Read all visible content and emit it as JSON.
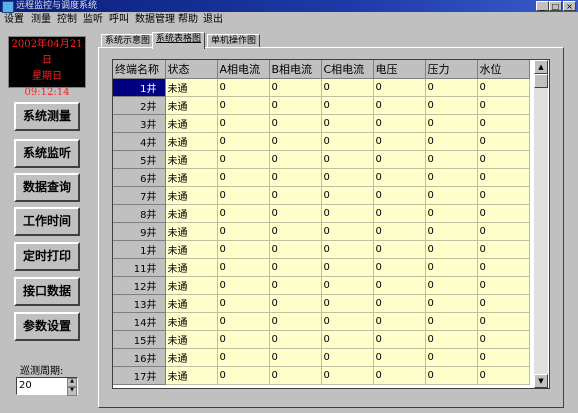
{
  "window": {
    "title": "远程监控与调度系统",
    "min": "_",
    "max": "□",
    "close": "×"
  },
  "menu": [
    "设置",
    "测量",
    "控制",
    "监听",
    "呼叫",
    "数据管理",
    "帮助",
    "退出"
  ],
  "clock": {
    "date": "2002年04月21日",
    "weekday": "星期日",
    "time": "09:12:14"
  },
  "side_buttons": [
    "系统测量",
    "系统监听",
    "数据查询",
    "工作时间",
    "定时打印",
    "接口数据",
    "参数设置"
  ],
  "period": {
    "label": "巡测周期:",
    "value": "20"
  },
  "tabs": [
    "系统示意图",
    "系统表格图",
    "单机操作图"
  ],
  "table": {
    "headers": [
      "终端名称",
      "状态",
      "A相电流",
      "B相电流",
      "C相电流",
      "电压",
      "压力",
      "水位"
    ],
    "rows": [
      [
        "1井",
        "未通",
        "0",
        "0",
        "0",
        "0",
        "0",
        "0"
      ],
      [
        "2井",
        "未通",
        "0",
        "0",
        "0",
        "0",
        "0",
        "0"
      ],
      [
        "3井",
        "未通",
        "0",
        "0",
        "0",
        "0",
        "0",
        "0"
      ],
      [
        "4井",
        "未通",
        "0",
        "0",
        "0",
        "0",
        "0",
        "0"
      ],
      [
        "5井",
        "未通",
        "0",
        "0",
        "0",
        "0",
        "0",
        "0"
      ],
      [
        "6井",
        "未通",
        "0",
        "0",
        "0",
        "0",
        "0",
        "0"
      ],
      [
        "7井",
        "未通",
        "0",
        "0",
        "0",
        "0",
        "0",
        "0"
      ],
      [
        "8井",
        "未通",
        "0",
        "0",
        "0",
        "0",
        "0",
        "0"
      ],
      [
        "9井",
        "未通",
        "0",
        "0",
        "0",
        "0",
        "0",
        "0"
      ],
      [
        "1井",
        "未通",
        "0",
        "0",
        "0",
        "0",
        "0",
        "0"
      ],
      [
        "11井",
        "未通",
        "0",
        "0",
        "0",
        "0",
        "0",
        "0"
      ],
      [
        "12井",
        "未通",
        "0",
        "0",
        "0",
        "0",
        "0",
        "0"
      ],
      [
        "13井",
        "未通",
        "0",
        "0",
        "0",
        "0",
        "0",
        "0"
      ],
      [
        "14井",
        "未通",
        "0",
        "0",
        "0",
        "0",
        "0",
        "0"
      ],
      [
        "15井",
        "未通",
        "0",
        "0",
        "0",
        "0",
        "0",
        "0"
      ],
      [
        "16井",
        "未通",
        "0",
        "0",
        "0",
        "0",
        "0",
        "0"
      ],
      [
        "17井",
        "未通",
        "0",
        "0",
        "0",
        "0",
        "0",
        "0"
      ]
    ]
  },
  "colors": {
    "titlebar": "#0a1e78",
    "grid_cell": "#ffffcc",
    "selected": "#000080",
    "clock_text": "#ff2020"
  },
  "icons": [
    "app-icon",
    "minimize-icon",
    "maximize-icon",
    "close-icon",
    "spin-up-icon",
    "spin-down-icon",
    "scroll-up-icon",
    "scroll-down-icon"
  ]
}
